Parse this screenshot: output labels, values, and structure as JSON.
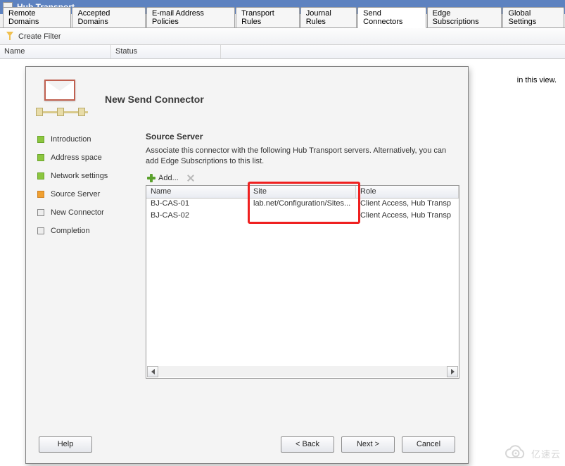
{
  "titlebar": "Hub Transport",
  "tabs": {
    "items": [
      "Remote Domains",
      "Accepted Domains",
      "E-mail Address Policies",
      "Transport Rules",
      "Journal Rules",
      "Send Connectors",
      "Edge Subscriptions",
      "Global Settings"
    ],
    "active_index": 5
  },
  "toolbar": {
    "filter_label": "Create Filter"
  },
  "list_headers": {
    "name": "Name",
    "status": "Status"
  },
  "background_hint": "in this view.",
  "dialog": {
    "title": "New Send Connector",
    "steps": [
      {
        "label": "Introduction",
        "state": "done"
      },
      {
        "label": "Address space",
        "state": "done"
      },
      {
        "label": "Network settings",
        "state": "done"
      },
      {
        "label": "Source Server",
        "state": "current"
      },
      {
        "label": "New Connector",
        "state": "pending"
      },
      {
        "label": "Completion",
        "state": "pending"
      }
    ],
    "section": {
      "heading": "Source Server",
      "description": "Associate this connector with the following Hub Transport servers. Alternatively, you can add Edge Subscriptions to this list.",
      "add_label": "Add...",
      "columns": {
        "name": "Name",
        "site": "Site",
        "role": "Role"
      },
      "rows": [
        {
          "name": "BJ-CAS-01",
          "site": "lab.net/Configuration/Sites...",
          "role": "Client Access, Hub Transp"
        },
        {
          "name": "BJ-CAS-02",
          "site": "",
          "role": "Client Access, Hub Transp"
        }
      ]
    },
    "buttons": {
      "help": "Help",
      "back": "< Back",
      "next": "Next >",
      "cancel": "Cancel"
    }
  },
  "watermark": "亿速云"
}
